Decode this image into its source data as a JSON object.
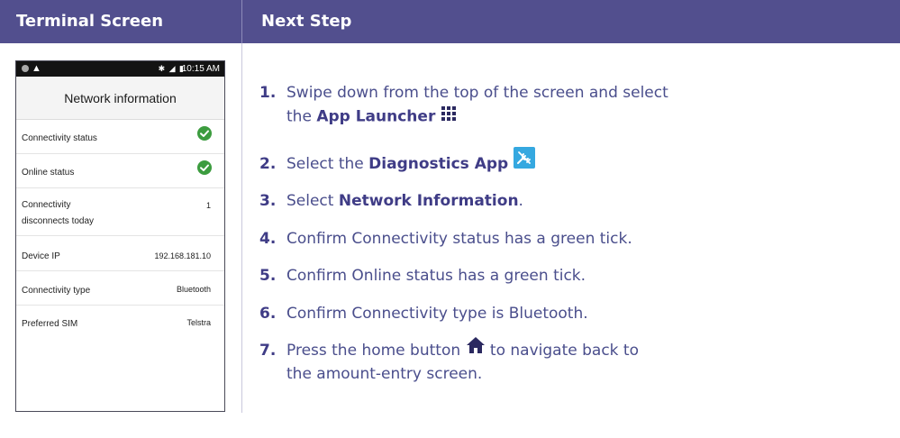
{
  "header": {
    "left_title": "Terminal Screen",
    "right_title": "Next Step"
  },
  "terminal": {
    "status_bar": {
      "time": "10:15 AM",
      "icons": "✱ ◢ ▮"
    },
    "screen_title": "Network information",
    "rows": [
      {
        "label": "Connectivity status",
        "value": "",
        "tick": true
      },
      {
        "label": "Online status",
        "value": "",
        "tick": true
      },
      {
        "label": "Connectivity",
        "label2": "disconnects today",
        "value": "1"
      },
      {
        "label": "Device IP",
        "value": "192.168.181.10"
      },
      {
        "label": "Connectivity type",
        "value": "Bluetooth"
      },
      {
        "label": "Preferred SIM",
        "value": "Telstra"
      }
    ]
  },
  "steps": [
    {
      "num": "1.",
      "line1_pre": "Swipe down from the top of the screen and select",
      "line2_pre": "the ",
      "line2_bold": "App Launcher",
      "icon": "app-launcher-grid-icon"
    },
    {
      "num": "2.",
      "pre": "Select the ",
      "bold": "Diagnostics App",
      "icon": "diagnostics-app-icon"
    },
    {
      "num": "3.",
      "pre": "Select ",
      "bold": "Network Information",
      "post": "."
    },
    {
      "num": "4.",
      "text": "Confirm Connectivity status has a green tick."
    },
    {
      "num": "5.",
      "text": "Confirm Online status has a green tick."
    },
    {
      "num": "6.",
      "text": "Confirm Connectivity type is Bluetooth."
    },
    {
      "num": "7.",
      "line1_pre": "Press the home button",
      "line1_post": " to navigate back to",
      "line2": "the amount-entry screen.",
      "icon": "home-icon"
    }
  ],
  "colors": {
    "header_bg": "#524f8e",
    "step_text": "#4a4e8c",
    "tick_green": "#3c9c3f",
    "diagnostics_icon_bg": "#35a8e0"
  }
}
